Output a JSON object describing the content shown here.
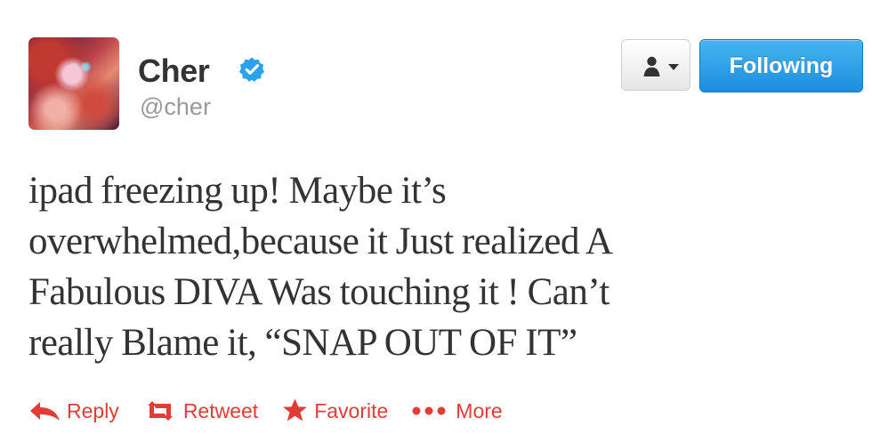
{
  "user": {
    "display_name": "Cher",
    "username": "@cher"
  },
  "header_actions": {
    "follow_state_label": "Following"
  },
  "tweet": {
    "text_lines": [
      "ipad freezing up! Maybe it’s",
      "overwhelmed,because it Just realized A",
      "Fabulous DIVA Was touching it ! Can’t",
      "really Blame it, “SNAP OUT OF IT”"
    ]
  },
  "actions": {
    "reply": "Reply",
    "retweet": "Retweet",
    "favorite": "Favorite",
    "more": "More"
  },
  "colors": {
    "text": "#333333",
    "secondary_text": "#999999",
    "verified_blue": "#2aa3ef",
    "follow_blue": "#1d8de0",
    "action_red": "#e13c36"
  },
  "icons": {
    "verified": "verified-badge-icon",
    "user_menu": "person-icon",
    "dropdown": "caret-down-icon",
    "reply": "reply-arrow-icon",
    "retweet": "retweet-icon",
    "favorite": "star-icon",
    "more": "more-dots-icon"
  }
}
